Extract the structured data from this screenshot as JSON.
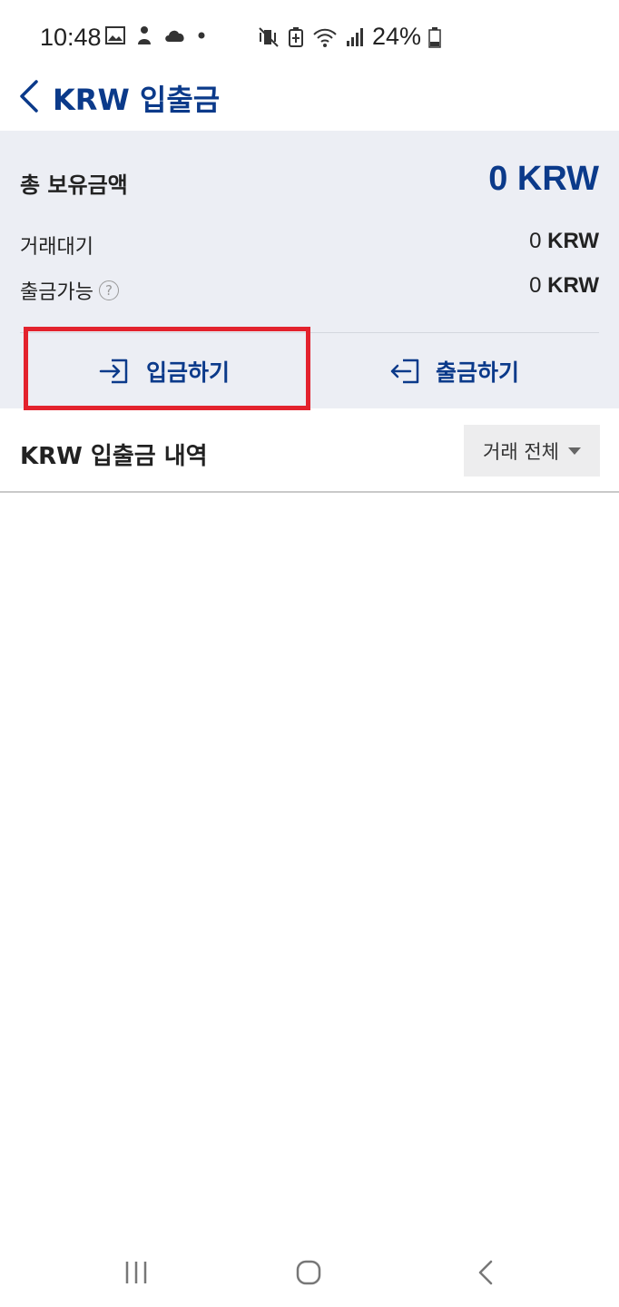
{
  "status_bar": {
    "time": "10:48",
    "battery": "24%",
    "left_icons": [
      "gallery-icon",
      "notification-icon",
      "cloud-icon",
      "dot-icon"
    ],
    "right_icons": [
      "vibrate-mute-icon",
      "battery-saver-icon",
      "wifi-icon",
      "signal-icon",
      "battery-icon"
    ]
  },
  "header": {
    "title": "KRW 입출금"
  },
  "summary": {
    "total_label": "총 보유금액",
    "total_value": "0 KRW",
    "pending_label": "거래대기",
    "pending_amount": "0",
    "pending_unit": "KRW",
    "available_label": "출금가능",
    "available_amount": "0",
    "available_unit": "KRW",
    "help_glyph": "?"
  },
  "actions": {
    "deposit_label": "입금하기",
    "withdraw_label": "출금하기"
  },
  "history": {
    "title": "KRW 입출금 내역",
    "filter_value": "거래 전체"
  },
  "colors": {
    "brand": "#0b3a8a",
    "highlight": "#e3222d",
    "summary_bg": "#eceef4"
  }
}
